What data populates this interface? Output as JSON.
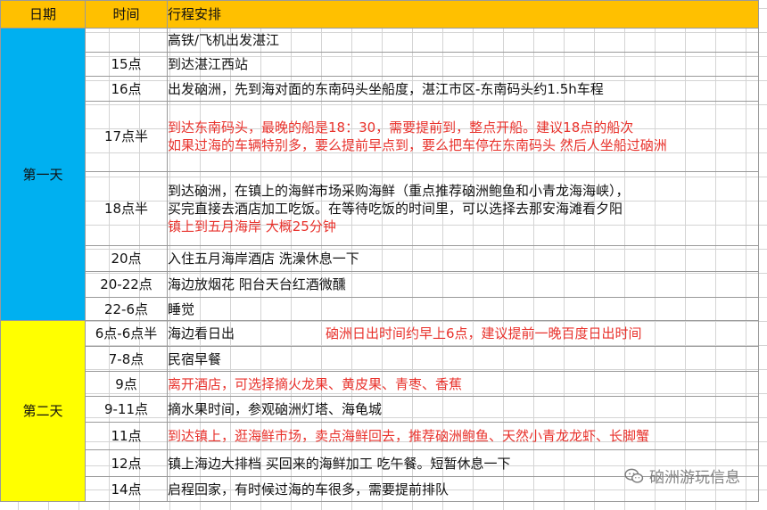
{
  "headers": {
    "date": "日期",
    "time": "时间",
    "plan": "行程安排"
  },
  "days": [
    {
      "label": "第一天",
      "rows": [
        {
          "time": "",
          "lines": [
            {
              "text": "高铁/飞机出发湛江",
              "color": "black"
            }
          ]
        },
        {
          "time": "15点",
          "lines": [
            {
              "text": "到达湛江西站",
              "color": "black"
            }
          ]
        },
        {
          "time": "16点",
          "lines": [
            {
              "text": "出发硇洲，先到海对面的东南码头坐船度，湛江市区-东南码头约1.5h车程",
              "color": "black"
            }
          ]
        },
        {
          "time": "17点半",
          "lines": [
            {
              "text": "到达东南码头，最晚的船是18：30，需要提前到，整点开船。建议18点的船次",
              "color": "red"
            },
            {
              "text": "如果过海的车辆特别多，要么提前早点到，要么把车停在东南码头 然后人坐船过硇洲",
              "color": "red"
            }
          ]
        },
        {
          "time": "18点半",
          "lines": [
            {
              "text": "到达硇洲，在镇上的海鲜市场采购海鲜（重点推荐硇洲鲍鱼和小青龙海海峡），",
              "color": "black"
            },
            {
              "text": "买完直接去酒店加工吃饭。在等待吃饭的时间里，可以选择去那安海滩看夕阳",
              "color": "black"
            },
            {
              "text": "镇上到五月海岸 大概25分钟",
              "color": "red"
            }
          ]
        },
        {
          "time": "20点",
          "lines": [
            {
              "text": "入住五月海岸酒店 洗澡休息一下",
              "color": "black"
            }
          ]
        },
        {
          "time": "20-22点",
          "lines": [
            {
              "text": "海边放烟花 阳台天台红酒微醺",
              "color": "black"
            }
          ]
        },
        {
          "time": "22-6点",
          "lines": [
            {
              "text": "睡觉",
              "color": "black"
            }
          ]
        }
      ]
    },
    {
      "label": "第二天",
      "rows": [
        {
          "time": "6点-6点半",
          "lines": [
            {
              "text": "海边看日出",
              "color": "black"
            }
          ],
          "note": {
            "text": "硇洲日出时间约早上6点，建议提前一晚百度日出时间",
            "color": "red"
          }
        },
        {
          "time": "7-8点",
          "lines": [
            {
              "text": "民宿早餐",
              "color": "black"
            }
          ]
        },
        {
          "time": "9点",
          "lines": [
            {
              "text": "离开酒店，可选择摘火龙果、黄皮果、青枣、香蕉",
              "color": "red"
            }
          ]
        },
        {
          "time": "9-11点",
          "lines": [
            {
              "text": "摘水果时间，参观硇洲灯塔、海龟城",
              "color": "black"
            }
          ]
        },
        {
          "time": "11点",
          "lines": [
            {
              "text": "到达镇上，逛海鲜市场，卖点海鲜回去，推荐硇洲鲍鱼、天然小青龙龙虾、长脚蟹",
              "color": "red"
            }
          ]
        },
        {
          "time": "12点",
          "lines": [
            {
              "text": "镇上海边大排档 买回来的海鲜加工 吃午餐。短暂休息一下",
              "color": "black"
            }
          ]
        },
        {
          "time": "14点",
          "lines": [
            {
              "text": "启程回家，有时候过海的车很多，需要提前排队",
              "color": "black"
            }
          ]
        }
      ]
    }
  ],
  "watermark": {
    "text": "硇洲游玩信息",
    "icon": "wechat-icon"
  }
}
